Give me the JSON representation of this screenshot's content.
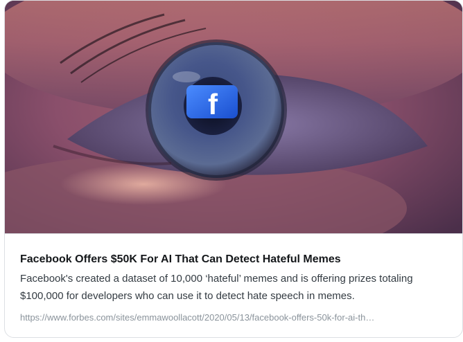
{
  "card": {
    "image_alt": "Facebook logo reflected in a person's eye",
    "image_logo": "f",
    "title": "Facebook Offers $50K For AI That Can Detect Hateful Memes",
    "description": "Facebook's created a dataset of 10,000 ‘hateful’ memes and is offering prizes totaling $100,000 for developers who can use it to detect hate speech in memes.",
    "url": "https://www.forbes.com/sites/emmawoollacott/2020/05/13/facebook-offers-50k-for-ai-th…"
  },
  "colors": {
    "title": "#14171a",
    "description": "#333b42",
    "url": "#8a939b",
    "border": "#dcdfe3",
    "facebook_blue": "#1877f2"
  }
}
